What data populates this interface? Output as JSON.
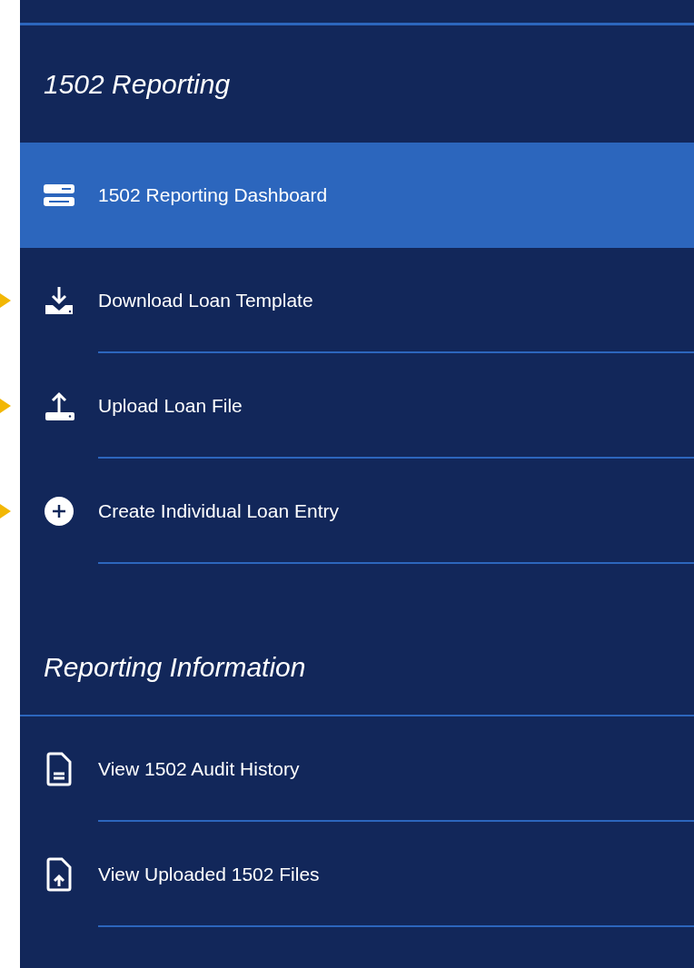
{
  "sections": [
    {
      "title": "1502 Reporting",
      "items": [
        {
          "label": "1502 Reporting Dashboard",
          "selected": true,
          "marked": false
        },
        {
          "label": "Download Loan Template",
          "selected": false,
          "marked": true
        },
        {
          "label": "Upload Loan File",
          "selected": false,
          "marked": true
        },
        {
          "label": "Create Individual Loan Entry",
          "selected": false,
          "marked": true
        }
      ]
    },
    {
      "title": "Reporting Information",
      "items": [
        {
          "label": "View 1502 Audit History",
          "selected": false,
          "marked": false
        },
        {
          "label": "View Uploaded 1502 Files",
          "selected": false,
          "marked": false
        }
      ]
    }
  ]
}
